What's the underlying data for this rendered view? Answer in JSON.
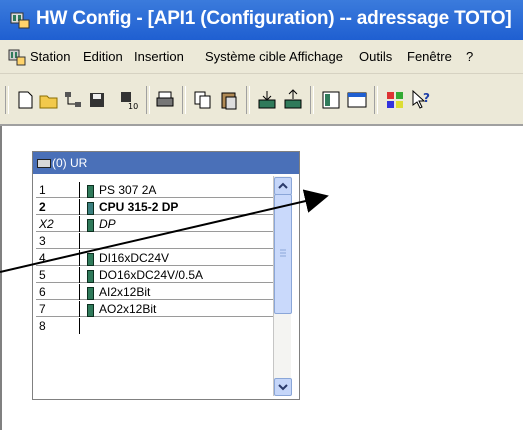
{
  "window": {
    "title": "HW Config - [API1 (Configuration) -- adressage TOTO]"
  },
  "menu": [
    "Station",
    "Edition",
    "Insertion",
    "Système cible",
    "Affichage",
    "Outils",
    "Fenêtre",
    "?"
  ],
  "toolbar": {
    "icons": [
      "new-icon",
      "open-icon",
      "network-icon",
      "save-icon",
      "compile-icon",
      "print-icon",
      "copy-icon",
      "paste-icon",
      "download-icon",
      "upload-icon",
      "catalog-icon",
      "window-icon",
      "diagnostic-icon",
      "help-icon"
    ]
  },
  "rack": {
    "title": "(0) UR",
    "rows": [
      {
        "slot": "1",
        "name": "PS 307 2A"
      },
      {
        "slot": "2",
        "name": "CPU 315-2 DP"
      },
      {
        "slot": "X2",
        "name": "DP"
      },
      {
        "slot": "3",
        "name": ""
      },
      {
        "slot": "4",
        "name": "DI16xDC24V"
      },
      {
        "slot": "5",
        "name": "DO16xDC24V/0.5A"
      },
      {
        "slot": "6",
        "name": "AI2x12Bit"
      },
      {
        "slot": "7",
        "name": "AO2x12Bit"
      },
      {
        "slot": "8",
        "name": ""
      }
    ]
  },
  "colors": {
    "title_bar": "#1f5fd1",
    "rack_header": "#4a70b8",
    "menu_bg": "#ece9d8",
    "module": "#2f7a5a"
  }
}
